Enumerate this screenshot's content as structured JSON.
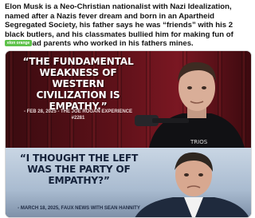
{
  "post": {
    "text": "Elon Musk is a Neo-Christian nationalist with Nazi Idealization, named after a Nazis fever dream and born in an Apartheid Segregated Society, his father says he was “friends” with his 2 black butlers, and his classmates bullied him for making fun of their dead parents who worked in his fathers mines.",
    "badge": "elon orange"
  },
  "media": {
    "top_panel": {
      "quote": "“The fundamental weakness of western civilization is empathy.”",
      "attribution": "- Feb 28, 2025 - The Joe Rogan Experience #2281",
      "mic_label": "TRIOS"
    },
    "bottom_panel": {
      "quote": "“I thought the left was the party of empathy?”",
      "attribution": "- March 18, 2025, Faux News with Sean Hannity"
    }
  },
  "colors": {
    "badge": "#5ec24a",
    "top_background": "#5e1119",
    "bottom_background": "#a9bbd0"
  }
}
